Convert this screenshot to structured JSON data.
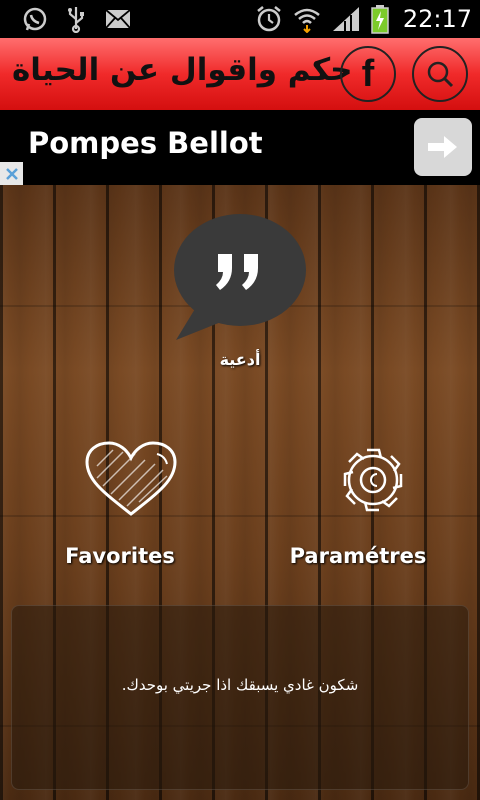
{
  "status_bar": {
    "time": "22:17",
    "icons": [
      "whatsapp-icon",
      "usb-icon",
      "mail-icon",
      "alarm-icon",
      "wifi-icon",
      "signal-icon",
      "battery-charging-icon"
    ]
  },
  "app_bar": {
    "title": "حكم واقوال عن الحياة",
    "color": "#e81c1c",
    "facebook_label": "f",
    "search_icon": "search-icon"
  },
  "ad": {
    "text": "Pompes Bellot",
    "arrow_icon": "arrow-right-icon",
    "close_icon": "close-icon"
  },
  "menu": {
    "quotes_label": "أدعية",
    "favorites_label": "Favorites",
    "settings_label": "Paramétres"
  },
  "quote": {
    "text": "شكون غادي يسبقك اذا جريتي بوحدك."
  }
}
